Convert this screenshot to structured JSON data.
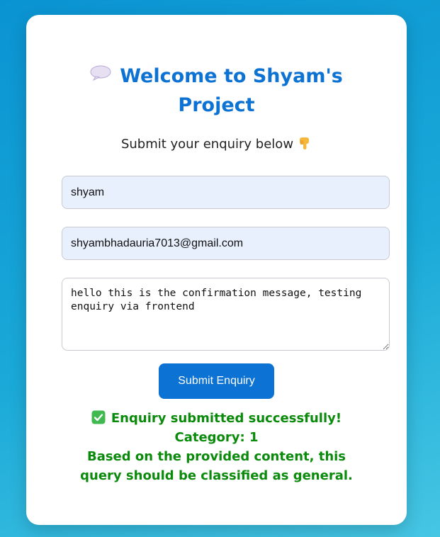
{
  "header": {
    "title": "Welcome to Shyam's Project",
    "title_icon": "speech-bubble-icon",
    "subtitle": "Submit your enquiry below",
    "subtitle_icon": "pointing-down-hand-icon"
  },
  "form": {
    "name_value": "shyam",
    "email_value": "shyambhadauria7013@gmail.com",
    "message_value": "hello this is the confirmation message, testing enquiry via frontend",
    "submit_label": "Submit Enquiry"
  },
  "result": {
    "icon": "check-mark-icon",
    "line1": "Enquiry submitted successfully! Category: 1",
    "line2": "Based on the provided content, this query should be classified as general."
  },
  "colors": {
    "accent": "#0c72d4",
    "success": "#0a8a0a",
    "input_autofill": "#e8f0fe"
  }
}
